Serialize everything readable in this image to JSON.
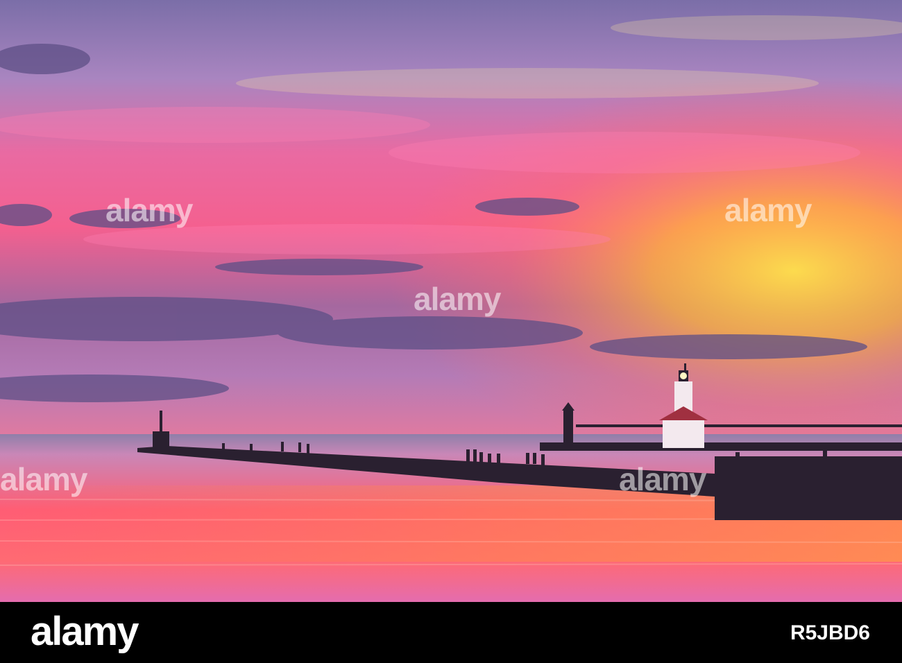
{
  "watermark": {
    "text": "alamy"
  },
  "footer": {
    "logo": "alamy",
    "image_id": "R5JBD6"
  },
  "colors": {
    "sky_top": "#7d6fa6",
    "sky_pink": "#f2559a",
    "sky_sunset": "#ffcc33",
    "horizon": "#c07ab0",
    "water_pink": "#ff5a6e",
    "silhouette": "#2a2030"
  }
}
